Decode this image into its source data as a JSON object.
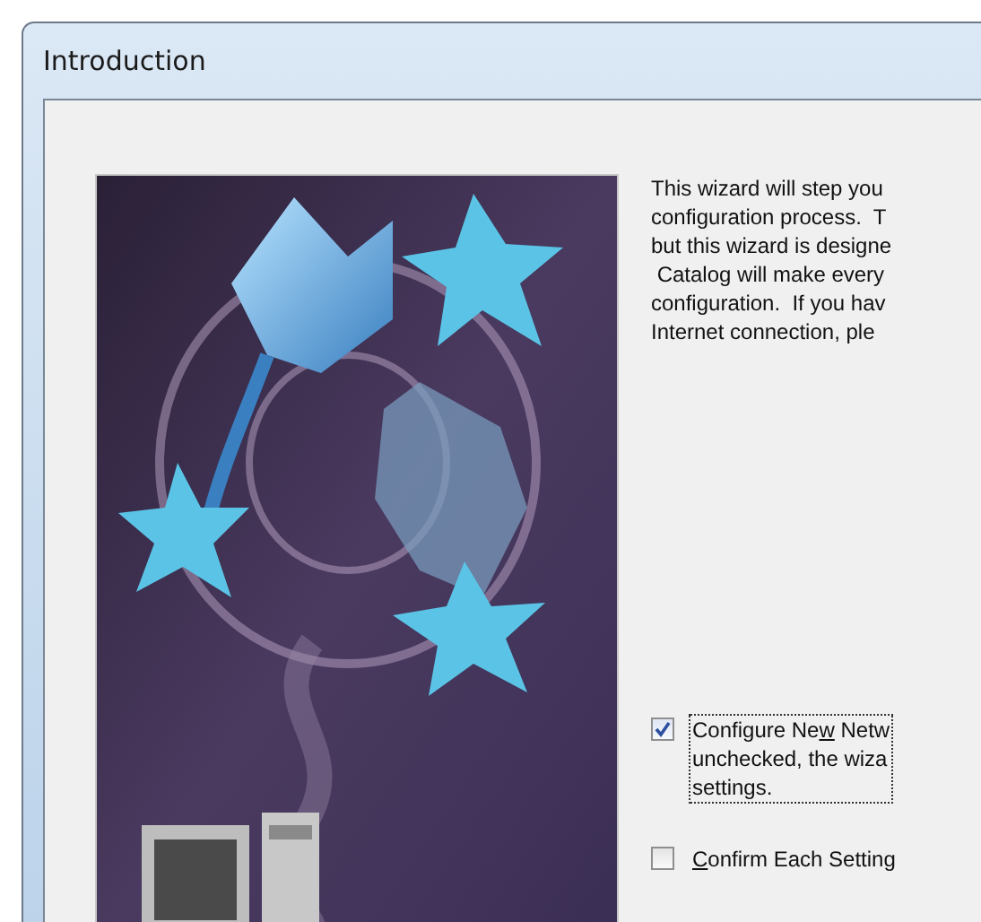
{
  "window": {
    "title": "Introduction"
  },
  "intro_lines": [
    "This wizard will step you",
    "configuration process.  T",
    "but this wizard is designe",
    " Catalog will make every",
    "configuration.  If you hav",
    "Internet connection, ple"
  ],
  "options": [
    {
      "label_lines": [
        {
          "before": "Configure Ne",
          "key": "w",
          "after": " Netw"
        },
        {
          "before": "unchecked, the wiza"
        },
        {
          "before": "settings."
        }
      ],
      "checked": true,
      "focused": true
    },
    {
      "label_lines": [
        {
          "key": "C",
          "after": "onfirm Each Setting"
        }
      ],
      "checked": false,
      "focused": false
    }
  ]
}
